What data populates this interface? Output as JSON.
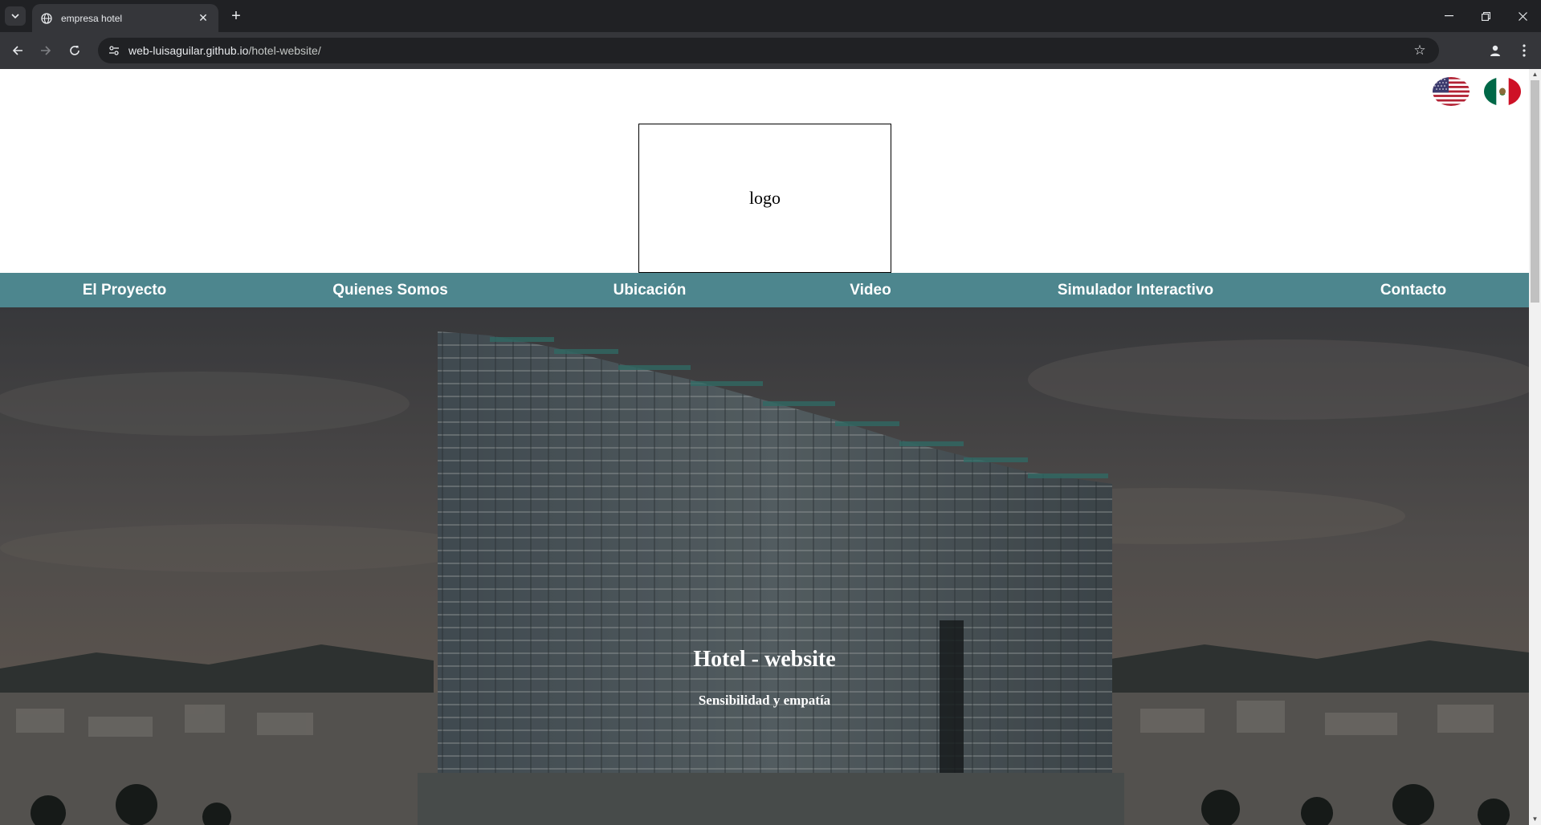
{
  "browser": {
    "tab_title": "empresa hotel",
    "url_host": "web-luisaguilar.github.io",
    "url_path": "/hotel-website/"
  },
  "header": {
    "logo_text": "logo",
    "flags": [
      "us-flag-icon",
      "mexico-flag-icon"
    ]
  },
  "nav": {
    "items": [
      "El Proyecto",
      "Quienes Somos",
      "Ubicación",
      "Video",
      "Simulador Interactivo",
      "Contacto"
    ]
  },
  "hero": {
    "title": "Hotel - website",
    "subtitle": "Sensibilidad y empatía"
  },
  "colors": {
    "nav_bg": "#4d868e",
    "nav_text": "#ffffff",
    "chrome_bg": "#202124",
    "toolbar_bg": "#35363a"
  }
}
